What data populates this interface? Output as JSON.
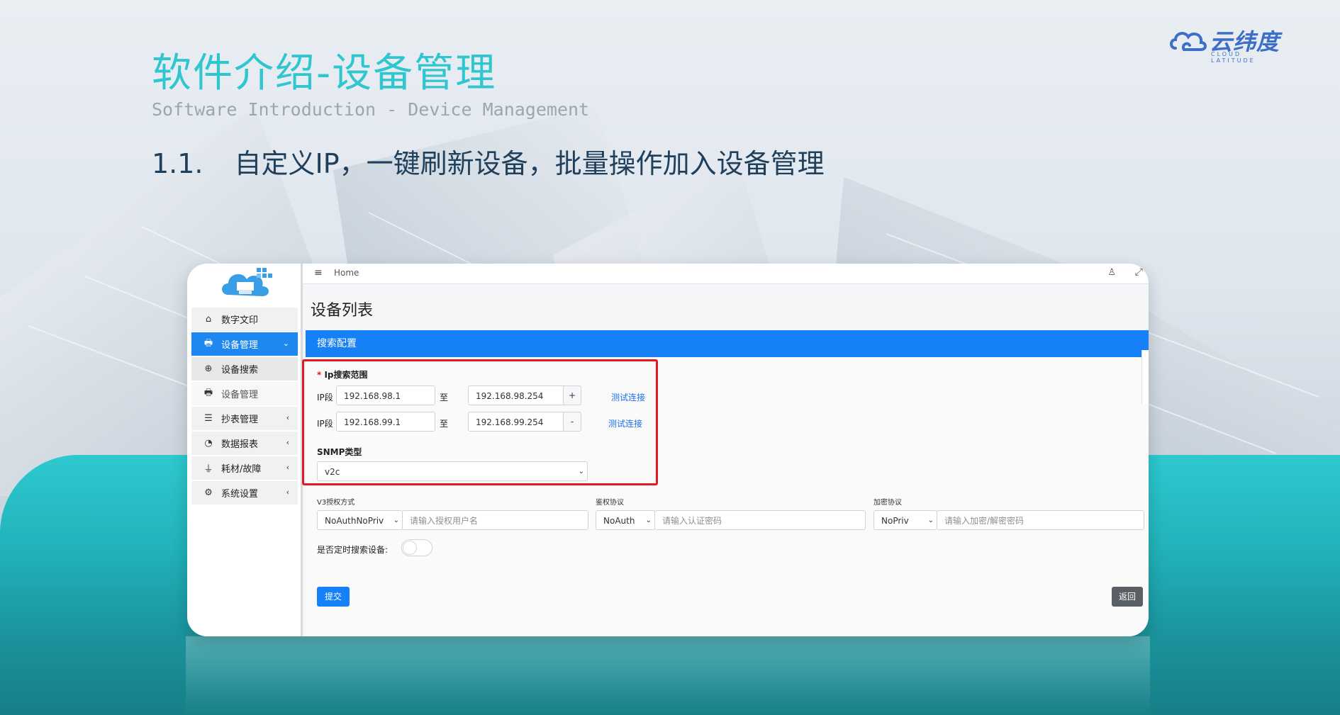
{
  "slide": {
    "title": "软件介绍-设备管理",
    "subtitle": "Software Introduction - Device Management",
    "point_number": "1.1.",
    "point_text": "自定义IP，一键刷新设备，批量操作加入设备管理"
  },
  "brand": {
    "name": "云纬度",
    "name_en": "CLOUD LATITUDE"
  },
  "app": {
    "topbar": {
      "home": "Home"
    },
    "sidebar": {
      "items": [
        {
          "label": "数字文印",
          "icon": "home-icon"
        },
        {
          "label": "设备管理",
          "icon": "printer-icon",
          "active": true,
          "expanded": true
        },
        {
          "label": "设备搜索",
          "icon": "search-plus-icon",
          "sub": true
        },
        {
          "label": "设备管理",
          "icon": "printer-icon",
          "sub": true
        },
        {
          "label": "抄表管理",
          "icon": "list-icon"
        },
        {
          "label": "数据报表",
          "icon": "pie-chart-icon"
        },
        {
          "label": "耗材/故障",
          "icon": "plug-icon"
        },
        {
          "label": "系统设置",
          "icon": "cogs-icon"
        }
      ]
    },
    "page_title": "设备列表",
    "section_title": "搜索配置",
    "form": {
      "ip_range_label": "Ip搜索范围",
      "ip_rows": [
        {
          "label": "IP段",
          "from": "192.168.98.1",
          "to_label": "至",
          "to": "192.168.98.254",
          "button": "+",
          "test_link": "测试连接"
        },
        {
          "label": "IP段",
          "from": "192.168.99.1",
          "to_label": "至",
          "to": "192.168.99.254",
          "button": "-",
          "test_link": "测试连接"
        }
      ],
      "snmp_label": "SNMP类型",
      "snmp_value": "v2c",
      "v3_auth_label": "V3授权方式",
      "v3_auth_value": "NoAuthNoPriv",
      "v3_user_placeholder": "请输入授权用户名",
      "auth_protocol_label": "鉴权协议",
      "auth_protocol_value": "NoAuth",
      "auth_password_placeholder": "请输入认证密码",
      "encrypt_protocol_label": "加密协议",
      "encrypt_protocol_value": "NoPriv",
      "encrypt_password_placeholder": "请输入加密/解密密码",
      "timed_search_label": "是否定时搜索设备:",
      "timed_search_enabled": false,
      "submit_label": "提交",
      "back_label": "返回"
    }
  },
  "colors": {
    "title": "#2fc6cf",
    "primary": "#1680f6",
    "highlight_box": "#e11b22",
    "teal_band": "#22b3bb"
  }
}
